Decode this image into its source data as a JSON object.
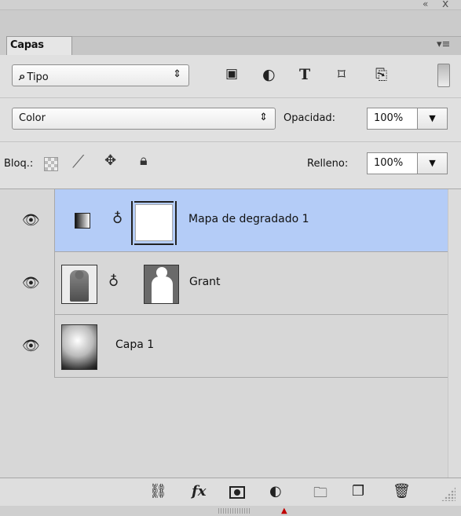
{
  "window": {
    "collapse_icon": "double-chevron-left-icon",
    "close_label": "x"
  },
  "panel": {
    "tab_label": "Capas",
    "menu_icon": "panel-menu-icon",
    "menu_glyph": "▾≡"
  },
  "filter": {
    "kind_label": "Tipo",
    "kind_icon": "search-icon",
    "icons": [
      "pixel-layer-filter-icon",
      "adjustment-layer-filter-icon",
      "type-layer-filter-icon",
      "shape-layer-filter-icon",
      "smart-object-filter-icon"
    ],
    "type_glyph": "T"
  },
  "blend": {
    "mode": "Color",
    "opacity_label": "Opacidad:",
    "opacity_value": "100%"
  },
  "lock": {
    "label": "Bloq.:",
    "icons": [
      "lock-transparent-pixels-icon",
      "lock-image-pixels-icon",
      "lock-position-icon",
      "lock-all-icon"
    ],
    "fill_label": "Relleno:",
    "fill_value": "100%"
  },
  "layers": [
    {
      "name": "Mapa de degradado 1",
      "visible": true,
      "selected": true,
      "kind": "adjustment"
    },
    {
      "name": "Grant",
      "visible": true,
      "selected": false,
      "kind": "photo-with-mask"
    },
    {
      "name": "Capa 1",
      "visible": true,
      "selected": false,
      "kind": "gradient"
    }
  ],
  "footer": {
    "icons": [
      "link-layers-icon",
      "fx-icon",
      "add-mask-icon",
      "new-adjustment-layer-icon",
      "new-group-icon",
      "new-layer-icon",
      "trash-icon"
    ],
    "fx_label": "fx"
  },
  "colors": {
    "selected_row": "#b4ccf7",
    "panel_bg": "#d7d7d7"
  }
}
